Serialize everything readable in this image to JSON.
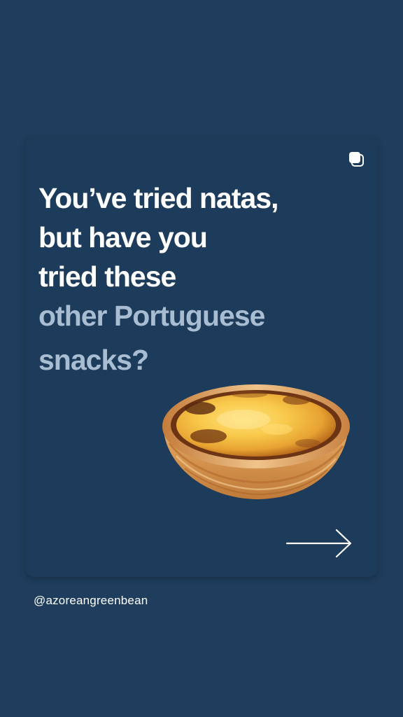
{
  "post": {
    "headline_white": [
      "You’ve tried natas,",
      "but have you",
      "tried these"
    ],
    "headline_accent": [
      "other Portuguese",
      "snacks?"
    ],
    "image": "pastel-de-nata-photo",
    "multi_post_icon": "carousel-icon",
    "next_icon": "right-arrow-icon"
  },
  "footer": {
    "handle": "@azoreangreenbean"
  },
  "colors": {
    "background": "#1f3d5c",
    "card": "#1d3b5a",
    "headline": "#ffffff",
    "accent": "#a9bdd2"
  }
}
